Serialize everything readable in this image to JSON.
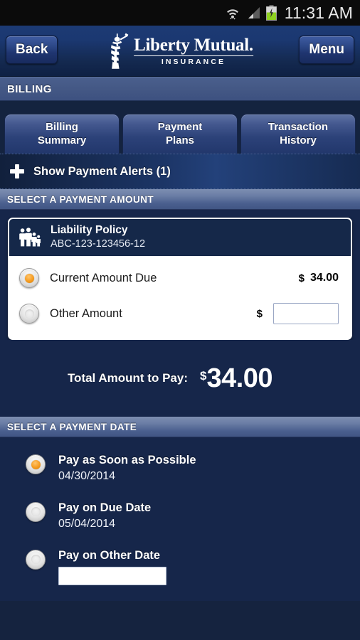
{
  "status_bar": {
    "time": "11:31 AM",
    "icons": [
      "wifi-icon",
      "signal-icon",
      "battery-charging-icon"
    ]
  },
  "header": {
    "back_label": "Back",
    "menu_label": "Menu",
    "brand_name": "Liberty Mutual.",
    "brand_sub": "INSURANCE",
    "logo_icon": "statue-of-liberty-icon"
  },
  "title_bar": {
    "title": "BILLING"
  },
  "tabs": [
    {
      "label": "Billing\nSummary",
      "line1": "Billing",
      "line2": "Summary"
    },
    {
      "label": "Payment\nPlans",
      "line1": "Payment",
      "line2": "Plans"
    },
    {
      "label": "Transaction\nHistory",
      "line1": "Transaction",
      "line2": "History"
    }
  ],
  "alerts_bar": {
    "icon": "plus-icon",
    "label": "Show Payment Alerts (1)"
  },
  "payment_amount": {
    "section_title": "SELECT A PAYMENT AMOUNT",
    "policy": {
      "icon": "family-icon",
      "name": "Liability Policy",
      "number": "ABC-123-123456-12"
    },
    "options": [
      {
        "label": "Current Amount Due",
        "selected": true,
        "currency": "$",
        "amount": "34.00",
        "type": "value"
      },
      {
        "label": "Other Amount",
        "selected": false,
        "currency": "$",
        "amount": "",
        "placeholder": "",
        "type": "input"
      }
    ]
  },
  "total": {
    "label": "Total Amount to Pay:",
    "currency": "$",
    "amount": "34.00"
  },
  "payment_date": {
    "section_title": "SELECT A PAYMENT DATE",
    "options": [
      {
        "title": "Pay as Soon as Possible",
        "date": "04/30/2014",
        "selected": true,
        "type": "text"
      },
      {
        "title": "Pay on Due Date",
        "date": "05/04/2014",
        "selected": false,
        "type": "text"
      },
      {
        "title": "Pay on Other Date",
        "date": "",
        "selected": false,
        "type": "input",
        "placeholder": ""
      }
    ]
  },
  "colors": {
    "brand_navy": "#16264a",
    "accent_orange": "#f59c21",
    "header_blue": "#1c3a74",
    "section_header": "#6b7ea6"
  }
}
